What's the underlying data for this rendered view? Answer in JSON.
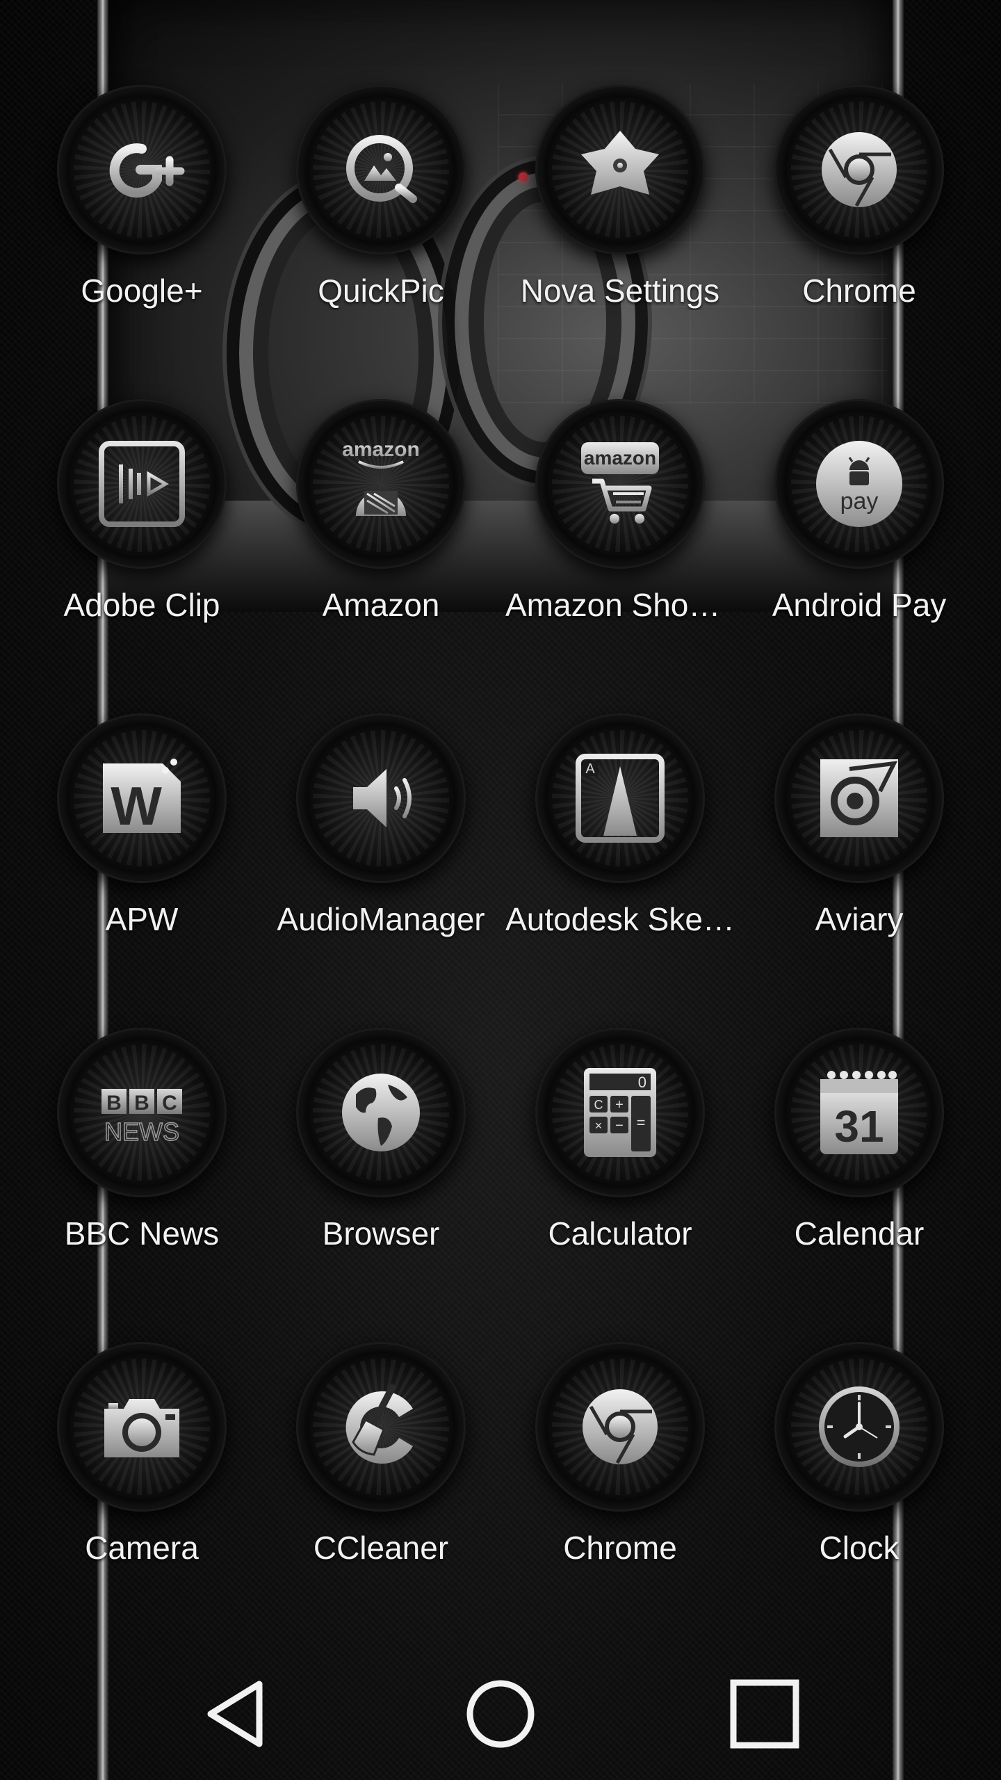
{
  "colors": {
    "background": "#050505",
    "label_text": "#f2f2f2",
    "icon_metal_light": "#e8e8e8",
    "icon_metal_dark": "#8c8c8c"
  },
  "apps": [
    {
      "label": "Google+",
      "icon": "google-plus-icon"
    },
    {
      "label": "QuickPic",
      "icon": "quickpic-icon"
    },
    {
      "label": "Nova Settings",
      "icon": "nova-settings-icon"
    },
    {
      "label": "Chrome",
      "icon": "chrome-icon"
    },
    {
      "label": "Adobe Clip",
      "icon": "adobe-clip-icon"
    },
    {
      "label": "Amazon",
      "icon": "amazon-icon"
    },
    {
      "label": "Amazon Shop…",
      "icon": "amazon-shopping-icon"
    },
    {
      "label": "Android Pay",
      "icon": "android-pay-icon"
    },
    {
      "label": "APW",
      "icon": "apw-icon"
    },
    {
      "label": "AudioManager",
      "icon": "speaker-icon"
    },
    {
      "label": "Autodesk Ske…",
      "icon": "sketchbook-icon"
    },
    {
      "label": "Aviary",
      "icon": "aviary-icon"
    },
    {
      "label": "BBC News",
      "icon": "bbc-news-icon"
    },
    {
      "label": "Browser",
      "icon": "globe-icon"
    },
    {
      "label": "Calculator",
      "icon": "calculator-icon"
    },
    {
      "label": "Calendar",
      "icon": "calendar-icon"
    },
    {
      "label": "Camera",
      "icon": "camera-icon"
    },
    {
      "label": "CCleaner",
      "icon": "ccleaner-icon"
    },
    {
      "label": "Chrome",
      "icon": "chrome-icon"
    },
    {
      "label": "Clock",
      "icon": "clock-icon"
    }
  ],
  "icon_text": {
    "amazon_wordmark": "amazon",
    "pay_text": "pay",
    "apw_letter": "W",
    "bbc_letters": [
      "B",
      "B",
      "C"
    ],
    "news_text": "NEWS",
    "calendar_day": "31",
    "calculator_display": "0",
    "calculator_keys": [
      "C",
      "+",
      "×",
      "−",
      "="
    ],
    "sketch_corner": "A"
  },
  "nav": {
    "back": "back-icon",
    "home": "home-icon",
    "recents": "recents-icon"
  }
}
